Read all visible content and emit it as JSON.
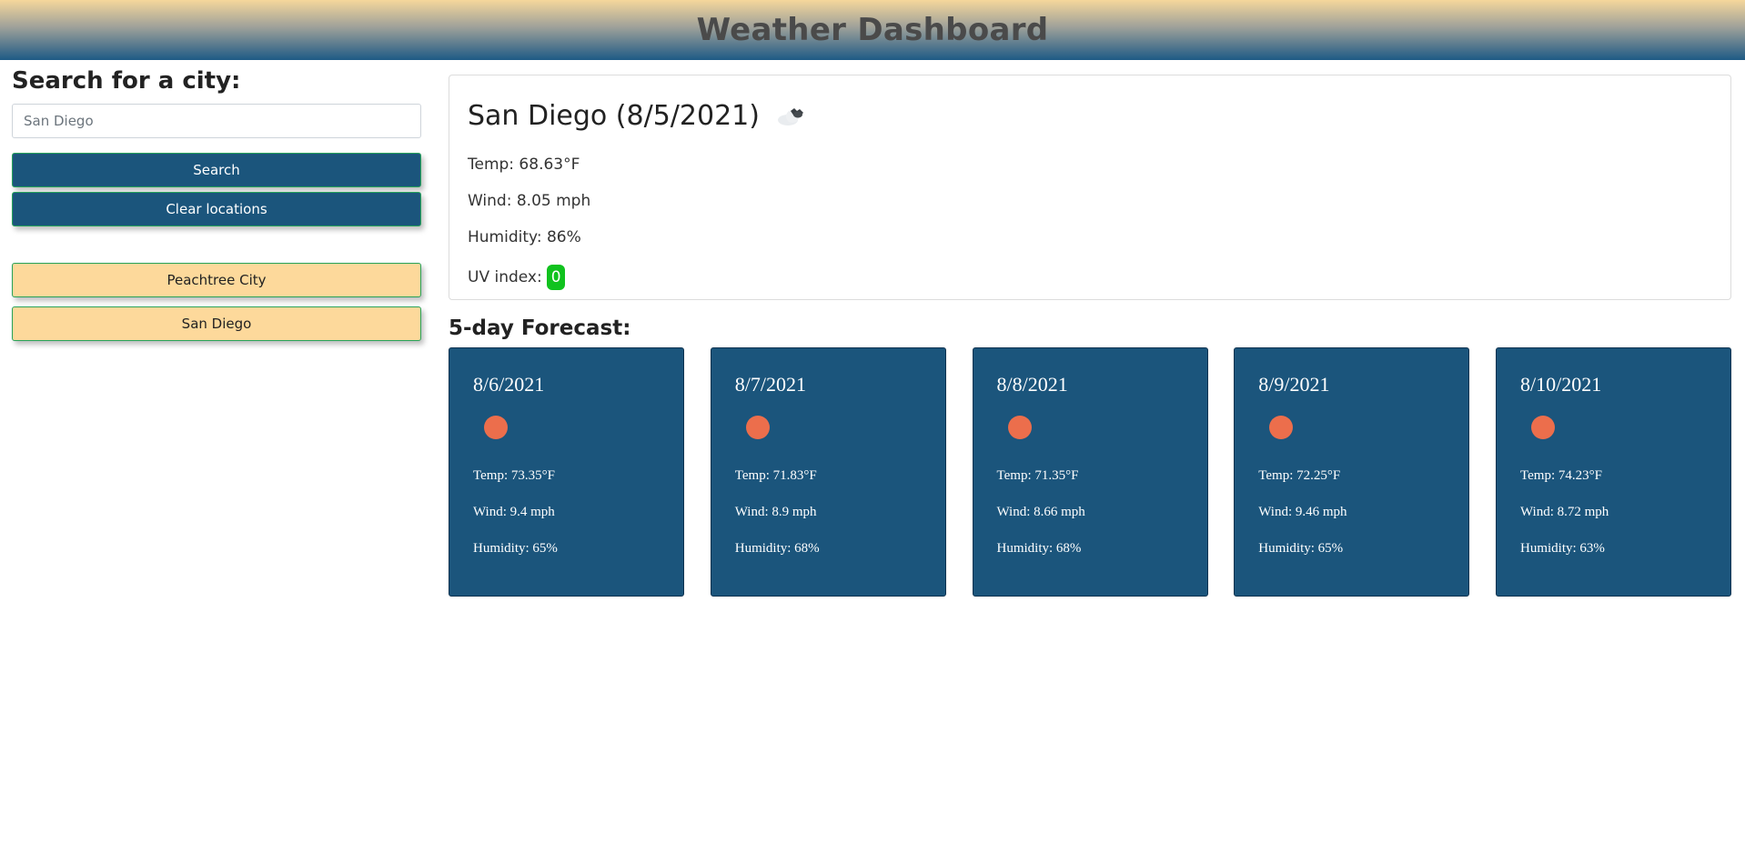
{
  "header": {
    "title": "Weather Dashboard"
  },
  "sidebar": {
    "heading": "Search for a city:",
    "search_placeholder": "San Diego",
    "search_button": "Search",
    "clear_button": "Clear locations",
    "history": [
      "Peachtree City",
      "San Diego"
    ]
  },
  "current": {
    "title": "San Diego (8/5/2021)",
    "icon": "cloud-icon",
    "temp": "Temp: 68.63°F",
    "wind": "Wind: 8.05 mph",
    "humidity": "Humidity: 86%",
    "uv_label": "UV index:",
    "uv_value": "0",
    "uv_color": "#10c21e"
  },
  "forecast": {
    "heading": "5-day Forecast:",
    "icon_color": "#ec6e4c",
    "days": [
      {
        "date": "8/6/2021",
        "icon": "sun-icon",
        "temp": "Temp: 73.35°F",
        "wind": "Wind: 9.4 mph",
        "humidity": "Humidity: 65%"
      },
      {
        "date": "8/7/2021",
        "icon": "sun-icon",
        "temp": "Temp: 71.83°F",
        "wind": "Wind: 8.9 mph",
        "humidity": "Humidity: 68%"
      },
      {
        "date": "8/8/2021",
        "icon": "sun-icon",
        "temp": "Temp: 71.35°F",
        "wind": "Wind: 8.66 mph",
        "humidity": "Humidity: 68%"
      },
      {
        "date": "8/9/2021",
        "icon": "sun-icon",
        "temp": "Temp: 72.25°F",
        "wind": "Wind: 9.46 mph",
        "humidity": "Humidity: 65%"
      },
      {
        "date": "8/10/2021",
        "icon": "sun-icon",
        "temp": "Temp: 74.23°F",
        "wind": "Wind: 8.72 mph",
        "humidity": "Humidity: 63%"
      }
    ]
  },
  "colors": {
    "primary": "#1b557c",
    "city_button": "#fdd99b",
    "button_border": "#27a35a"
  }
}
